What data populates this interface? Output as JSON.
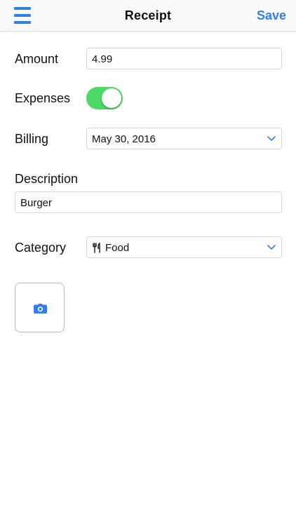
{
  "navbar": {
    "title": "Receipt",
    "save_label": "Save",
    "menu_icon": "hamburger-menu-icon"
  },
  "form": {
    "amount_label": "Amount",
    "amount_value": "4.99",
    "expenses_label": "Expenses",
    "expenses_toggle_on": true,
    "billing_label": "Billing",
    "billing_value": "May 30, 2016",
    "description_label": "Description",
    "description_value": "Burger",
    "category_label": "Category",
    "category_value": "Food",
    "category_icon": "fork-knife-icon"
  },
  "attachments": {
    "camera_icon": "camera-icon"
  },
  "colors": {
    "accent": "#2f80ed",
    "toggle_on": "#4cd964",
    "field_border": "#d7d7d7"
  }
}
